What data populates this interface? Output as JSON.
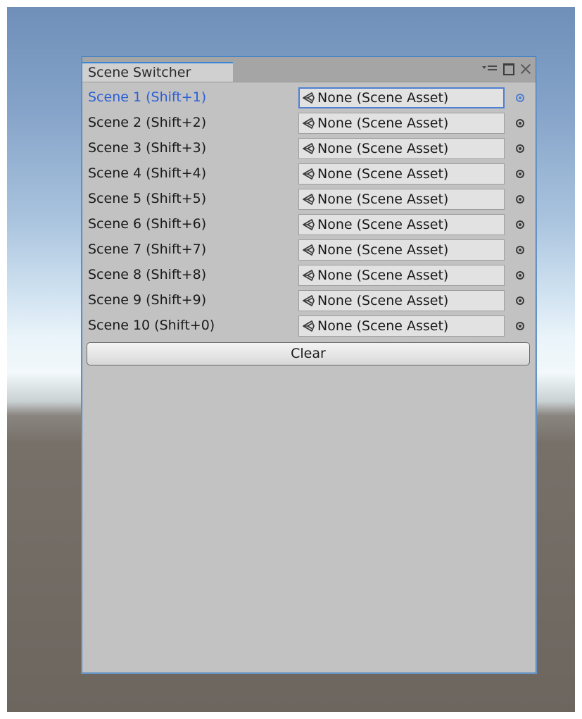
{
  "window": {
    "tab_title": "Scene Switcher"
  },
  "icons": {
    "panel_menu": "panel-menu-icon",
    "maximize": "maximize-icon",
    "close": "close-icon",
    "scene_asset": "unity-scene-icon",
    "object_picker": "object-picker-icon"
  },
  "colors": {
    "active_label": "#2b5fd8",
    "panel_bg": "#c2c2c2",
    "tab_accent": "#3a86d6"
  },
  "scenes": [
    {
      "label": "Scene 1 (Shift+1)",
      "value": "None (Scene Asset)",
      "active": true
    },
    {
      "label": "Scene 2 (Shift+2)",
      "value": "None (Scene Asset)",
      "active": false
    },
    {
      "label": "Scene 3 (Shift+3)",
      "value": "None (Scene Asset)",
      "active": false
    },
    {
      "label": "Scene 4 (Shift+4)",
      "value": "None (Scene Asset)",
      "active": false
    },
    {
      "label": "Scene 5 (Shift+5)",
      "value": "None (Scene Asset)",
      "active": false
    },
    {
      "label": "Scene 6 (Shift+6)",
      "value": "None (Scene Asset)",
      "active": false
    },
    {
      "label": "Scene 7 (Shift+7)",
      "value": "None (Scene Asset)",
      "active": false
    },
    {
      "label": "Scene 8 (Shift+8)",
      "value": "None (Scene Asset)",
      "active": false
    },
    {
      "label": "Scene 9 (Shift+9)",
      "value": "None (Scene Asset)",
      "active": false
    },
    {
      "label": "Scene 10 (Shift+0)",
      "value": "None (Scene Asset)",
      "active": false
    }
  ],
  "clear_button": "Clear"
}
